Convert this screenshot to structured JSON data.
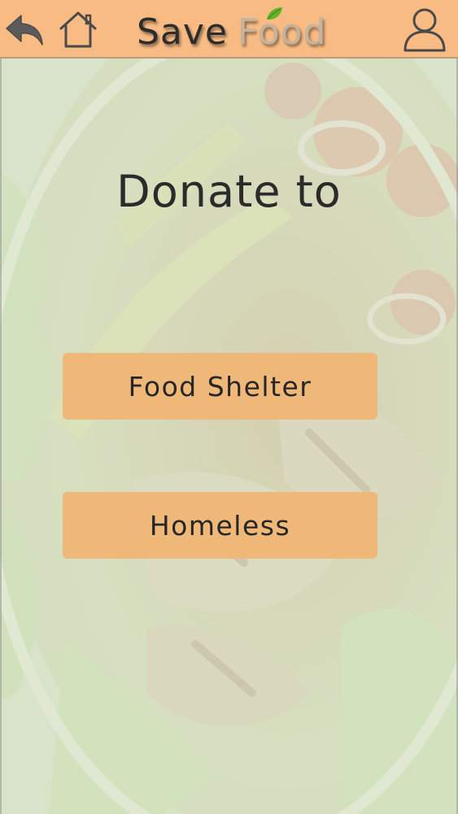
{
  "header": {
    "brand_save": "Save",
    "brand_food": "Food",
    "back_icon": "back-arrow-icon",
    "home_icon": "home-icon",
    "profile_icon": "user-icon",
    "leaf_icon": "leaf-icon"
  },
  "main": {
    "title": "Donate to",
    "options": [
      {
        "label": "Food Shelter"
      },
      {
        "label": "Homeless"
      }
    ]
  },
  "colors": {
    "header_bg": "#f8bb83",
    "button_bg": "#efb878",
    "leaf": "#5fb22a"
  }
}
